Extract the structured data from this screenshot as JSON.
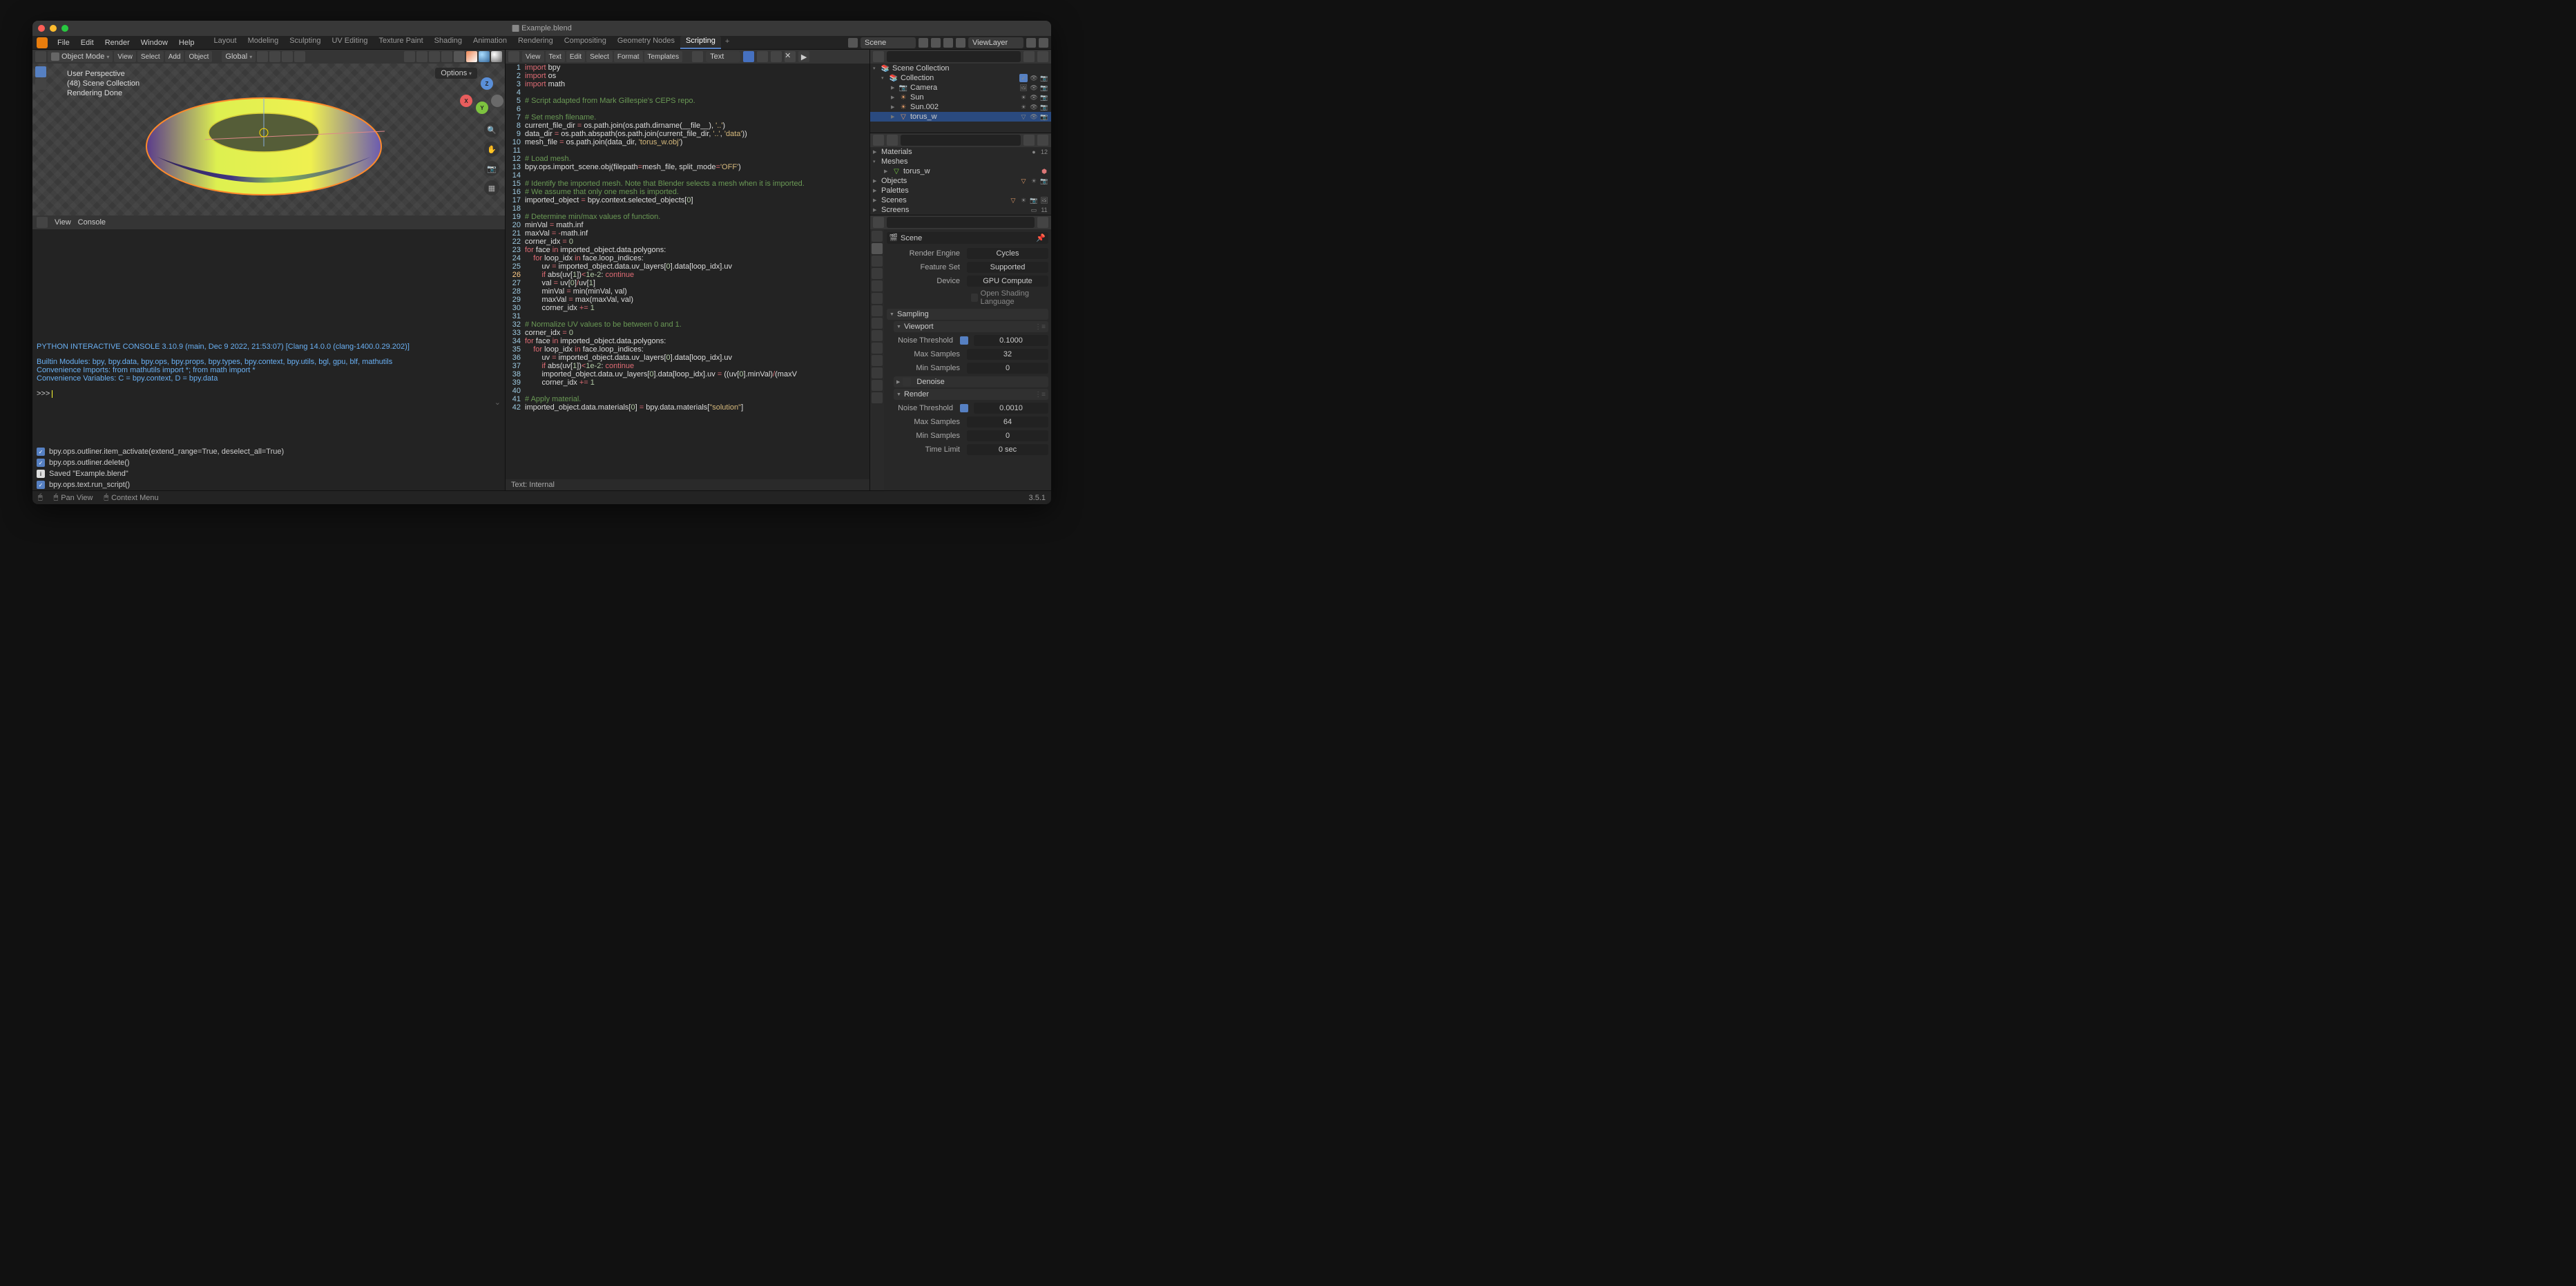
{
  "title": "Example.blend",
  "menus": [
    "File",
    "Edit",
    "Render",
    "Window",
    "Help"
  ],
  "workspace_tabs": [
    "Layout",
    "Modeling",
    "Sculpting",
    "UV Editing",
    "Texture Paint",
    "Shading",
    "Animation",
    "Rendering",
    "Compositing",
    "Geometry Nodes",
    "Scripting"
  ],
  "active_tab": "Scripting",
  "scene_selector": "Scene",
  "viewlayer_selector": "ViewLayer",
  "viewport": {
    "mode": "Object Mode",
    "view_label": "View",
    "select_label": "Select",
    "add_label": "Add",
    "object_label": "Object",
    "orientation": "Global",
    "info1": "User Perspective",
    "info2": "(48) Scene Collection",
    "info3": "Rendering Done",
    "options": "Options"
  },
  "console_header": {
    "view": "View",
    "console": "Console"
  },
  "console": {
    "l1": "PYTHON INTERACTIVE CONSOLE 3.10.9 (main, Dec  9 2022, 21:53:07) [Clang 14.0.0 (clang-1400.0.29.202)]",
    "l2": "Builtin Modules:       bpy, bpy.data, bpy.ops, bpy.props, bpy.types, bpy.context, bpy.utils, bgl, gpu, blf, mathutils",
    "l3": "Convenience Imports:   from mathutils import *; from math import *",
    "l4": "Convenience Variables: C = bpy.context, D = bpy.data",
    "prompt": ">>> "
  },
  "info": [
    {
      "t": "chk",
      "text": "bpy.ops.outliner.item_activate(extend_range=True, deselect_all=True)"
    },
    {
      "t": "chk",
      "text": "bpy.ops.outliner.delete()"
    },
    {
      "t": "info",
      "text": "Saved \"Example.blend\""
    },
    {
      "t": "chk",
      "text": "bpy.ops.text.run_script()"
    }
  ],
  "text_header": {
    "menus": [
      "View",
      "Text",
      "Edit",
      "Select",
      "Format",
      "Templates"
    ],
    "databrowse": "Text"
  },
  "code": [
    {
      "n": 1,
      "html": "<span class='kw'>import</span> bpy"
    },
    {
      "n": 2,
      "html": "<span class='kw'>import</span> os"
    },
    {
      "n": 3,
      "html": "<span class='kw'>import</span> math"
    },
    {
      "n": 4,
      "html": ""
    },
    {
      "n": 5,
      "html": "<span class='cmt'># Script adapted from Mark Gillespie's CEPS repo.</span>"
    },
    {
      "n": 6,
      "html": ""
    },
    {
      "n": 7,
      "html": "<span class='cmt'># Set mesh filename.</span>"
    },
    {
      "n": 8,
      "html": "current_file_dir <span class='op'>=</span> os.path.join(os.path.dirname(__file__), <span class='str'>'..'</span>)"
    },
    {
      "n": 9,
      "html": "data_dir <span class='op'>=</span> os.path.abspath(os.path.join(current_file_dir, <span class='str'>'..'</span>, <span class='str'>'data'</span>))"
    },
    {
      "n": 10,
      "html": "mesh_file <span class='op'>=</span> os.path.join(data_dir, <span class='str'>'torus_w.obj'</span>)"
    },
    {
      "n": 11,
      "html": ""
    },
    {
      "n": 12,
      "html": "<span class='cmt'># Load mesh.</span>"
    },
    {
      "n": 13,
      "html": "bpy.ops.import_scene.obj(filepath<span class='op'>=</span>mesh_file, split_mode<span class='op'>=</span><span class='str'>'OFF'</span>)"
    },
    {
      "n": 14,
      "html": ""
    },
    {
      "n": 15,
      "html": "<span class='cmt'># Identify the imported mesh. Note that Blender selects a mesh when it is imported.</span>"
    },
    {
      "n": 16,
      "html": "<span class='cmt'># We assume that only one mesh is imported.</span>"
    },
    {
      "n": 17,
      "html": "imported_object <span class='op'>=</span> bpy.context.selected_objects[<span class='num'>0</span>]"
    },
    {
      "n": 18,
      "html": ""
    },
    {
      "n": 19,
      "html": "<span class='cmt'># Determine min/max values of function.</span>"
    },
    {
      "n": 20,
      "html": "minVal <span class='op'>=</span> math.inf"
    },
    {
      "n": 21,
      "html": "maxVal <span class='op'>=</span> <span class='op'>-</span>math.inf"
    },
    {
      "n": 22,
      "html": "corner_idx <span class='op'>=</span> <span class='num'>0</span>"
    },
    {
      "n": 23,
      "html": "<span class='kw'>for</span> face <span class='kw'>in</span> imported_object.data.polygons:"
    },
    {
      "n": 24,
      "html": "    <span class='kw'>for</span> loop_idx <span class='kw'>in</span> face.loop_indices:"
    },
    {
      "n": 25,
      "html": "        uv <span class='op'>=</span> imported_object.data.uv_layers[<span class='num'>0</span>].data[loop_idx].uv"
    },
    {
      "n": 26,
      "html": "        <span class='kw'>if</span> abs(uv[<span class='num'>1</span>])<span class='op'>&lt;</span><span class='num'>1e-2</span>: <span class='kw'>continue</span>",
      "cur": true
    },
    {
      "n": 27,
      "html": "        val <span class='op'>=</span> uv[<span class='num'>0</span>]<span class='op'>/</span>uv[<span class='num'>1</span>]"
    },
    {
      "n": 28,
      "html": "        minVal <span class='op'>=</span> min(minVal, val)"
    },
    {
      "n": 29,
      "html": "        maxVal <span class='op'>=</span> max(maxVal, val)"
    },
    {
      "n": 30,
      "html": "        corner_idx <span class='op'>+=</span> <span class='num'>1</span>"
    },
    {
      "n": 31,
      "html": ""
    },
    {
      "n": 32,
      "html": "<span class='cmt'># Normalize UV values to be between 0 and 1.</span>"
    },
    {
      "n": 33,
      "html": "corner_idx <span class='op'>=</span> <span class='num'>0</span>"
    },
    {
      "n": 34,
      "html": "<span class='kw'>for</span> face <span class='kw'>in</span> imported_object.data.polygons:"
    },
    {
      "n": 35,
      "html": "    <span class='kw'>for</span> loop_idx <span class='kw'>in</span> face.loop_indices:"
    },
    {
      "n": 36,
      "html": "        uv <span class='op'>=</span> imported_object.data.uv_layers[<span class='num'>0</span>].data[loop_idx].uv"
    },
    {
      "n": 37,
      "html": "        <span class='kw'>if</span> abs(uv[<span class='num'>1</span>])<span class='op'>&lt;</span><span class='num'>1e-2</span>: <span class='kw'>continue</span>"
    },
    {
      "n": 38,
      "html": "        imported_object.data.uv_layers[<span class='num'>0</span>].data[loop_idx].uv <span class='op'>=</span> ((uv[<span class='num'>0</span>].minVal)<span class='op'>/</span>(maxV"
    },
    {
      "n": 39,
      "html": "        corner_idx <span class='op'>+=</span> <span class='num'>1</span>"
    },
    {
      "n": 40,
      "html": ""
    },
    {
      "n": 41,
      "html": "<span class='cmt'># Apply material.</span>"
    },
    {
      "n": 42,
      "html": "imported_object.data.materials[<span class='num'>0</span>] <span class='op'>=</span> bpy.data.materials[<span class='str'>\"solution\"</span>]"
    }
  ],
  "text_status": "Text: Internal",
  "outliner": {
    "root": "Scene Collection",
    "coll": "Collection",
    "items": [
      "Camera",
      "Sun",
      "Sun.002",
      "torus_w"
    ]
  },
  "datablock": {
    "materials": "Materials",
    "materials_count": "12",
    "meshes": "Meshes",
    "mesh": "torus_w",
    "objects": "Objects",
    "palettes": "Palettes",
    "scenes": "Scenes",
    "screens": "Screens",
    "screens_count": "11"
  },
  "props": {
    "bc": "Scene",
    "engine_l": "Render Engine",
    "engine_v": "Cycles",
    "feat_l": "Feature Set",
    "feat_v": "Supported",
    "dev_l": "Device",
    "dev_v": "GPU Compute",
    "osl": "Open Shading Language",
    "sampling": "Sampling",
    "viewport": "Viewport",
    "render": "Render",
    "denoise": "Denoise",
    "noise_l": "Noise Threshold",
    "noise_v1": "0.1000",
    "noise_v2": "0.0010",
    "max_l": "Max Samples",
    "max_v1": "32",
    "max_v2": "64",
    "min_l": "Min Samples",
    "min_v": "0",
    "time_l": "Time Limit",
    "time_v": "0 sec"
  },
  "footer": {
    "pan": "Pan View",
    "ctx": "Context Menu",
    "ver": "3.5.1"
  }
}
